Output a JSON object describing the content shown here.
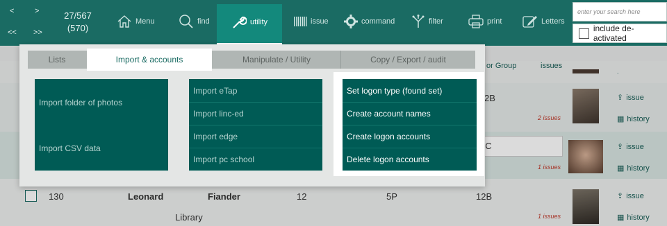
{
  "toolbar": {
    "nav": {
      "prev": "<",
      "next": ">",
      "first": "<<",
      "last": ">>"
    },
    "record_position": "27/567",
    "record_total": "(570)",
    "buttons": [
      {
        "label": "Menu",
        "icon": "home-icon"
      },
      {
        "label": "find",
        "icon": "search-icon"
      },
      {
        "label": "utility",
        "icon": "wrench-icon"
      },
      {
        "label": "issue",
        "icon": "barcode-icon"
      },
      {
        "label": "command",
        "icon": "gear-icon"
      },
      {
        "label": "filter",
        "icon": "filter-icon"
      },
      {
        "label": "print",
        "icon": "printer-icon"
      },
      {
        "label": "Letters",
        "icon": "edit-icon"
      }
    ],
    "search_placeholder": "enter your search here",
    "include_inactive_label": "include de-activated"
  },
  "list": {
    "headers": {
      "tutor_group": "or Group",
      "issues": "issues"
    },
    "rows": [
      {
        "class": "2B",
        "issues": "2 issues",
        "photo": "student-photo-1"
      },
      {
        "class": "2C",
        "issues": "1 issues",
        "photo": "student-photo-2"
      },
      {
        "id": "130",
        "first_name": "Leonard",
        "last_name": "Fiander",
        "year": "12",
        "room": "5P",
        "class": "12B",
        "issues": "1 issues",
        "location": "Library",
        "photo": "student-photo-3"
      }
    ],
    "side_actions": {
      "issue": "issue",
      "history": "history"
    }
  },
  "utility_menu": {
    "tabs": [
      {
        "label": "Lists",
        "active": false
      },
      {
        "label": "Import & accounts",
        "active": true
      },
      {
        "label": "Manipulate / Utility",
        "active": false
      },
      {
        "label": "Copy / Export / audit",
        "active": false
      }
    ],
    "import_photos": [
      "Import folder of photos",
      "Import CSV data"
    ],
    "import_sources": [
      "Import eTap",
      "Import linc-ed",
      "Import edge",
      "Import pc school"
    ],
    "logon_actions": [
      "Set logon type (found set)",
      "Create account names",
      "Create logon accounts",
      "Delete logon accounts"
    ]
  },
  "colors": {
    "toolbar": "#1a6b63",
    "toolbar_active": "#13897c",
    "menu_column": "#005b55",
    "issues_red": "#c0392b"
  }
}
